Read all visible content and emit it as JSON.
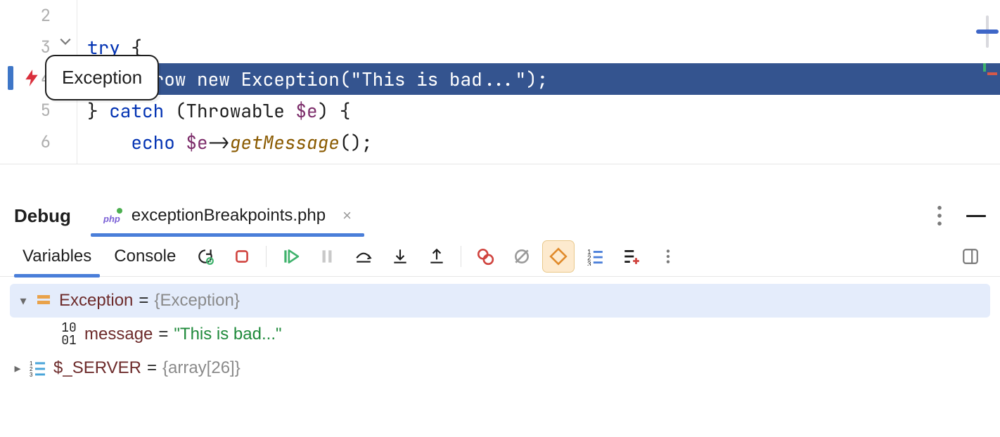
{
  "editor": {
    "lines": {
      "2": "2",
      "3": "3",
      "4": "4",
      "5": "5",
      "6": "6"
    },
    "tooltip": "Exception",
    "code3": {
      "kw": "try",
      "rest": " {"
    },
    "code4": {
      "indent": "    ",
      "throw": "throw",
      "new": "new",
      "cls": "Exception",
      "open": "(",
      "str": "\"This is bad...\"",
      "close": ");"
    },
    "code5": {
      "brace": "} ",
      "catch": "catch",
      "open": " (",
      "type": "Throwable",
      "var": " $e",
      "close": ") {"
    },
    "code6": {
      "indent": "    ",
      "echo": "echo",
      "space": " ",
      "var": "$e",
      "arrow": "->",
      "mth": "getMessage",
      "call": "();"
    }
  },
  "debug": {
    "title": "Debug",
    "tab": "exceptionBreakpoints.php",
    "tab_close": "×",
    "subtabs": {
      "variables": "Variables",
      "console": "Console"
    }
  },
  "vars": {
    "exc": {
      "name": "Exception",
      "eq": "=",
      "val": "{Exception}"
    },
    "msg": {
      "name": "message",
      "eq": "=",
      "val": "\"This is bad...\""
    },
    "srv": {
      "name": "$_SERVER",
      "eq": "=",
      "val": "{array[26]}"
    }
  }
}
